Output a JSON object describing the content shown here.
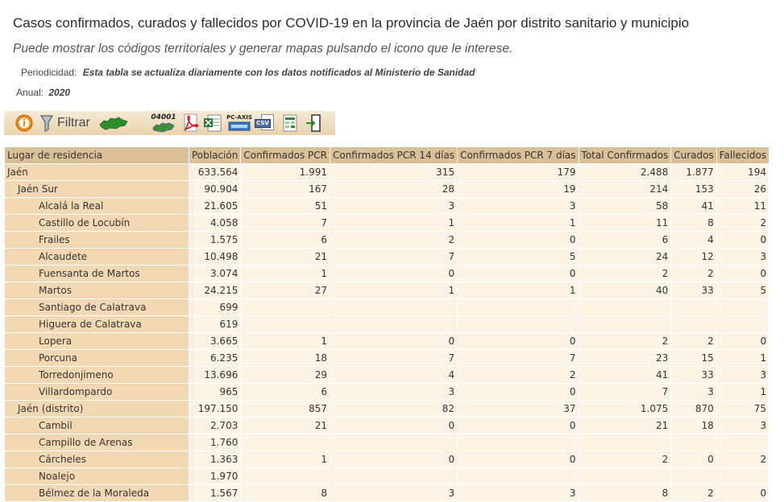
{
  "header": {
    "title": "Casos confirmados, curados y fallecidos por COVID-19 en la provincia de Jaén por distrito sanitario y municipio",
    "subtitle": "Puede mostrar los códigos territoriales y generar mapas pulsando el icono que le interese.",
    "periodicidad_label": "Periodicidad:",
    "periodicidad_value": "Esta tabla se actualiza diariamente con los datos notificados al Ministerio de Sanidad",
    "anual_label": "Anual:",
    "anual_value": "2020"
  },
  "toolbar": {
    "filter_label": "Filtrar",
    "codes_label": "04001",
    "pcaxis_label": "PC-AXIS",
    "csv_label": "CSV",
    "icons": [
      "info-icon",
      "filter-icon",
      "map-icon",
      "codes-map-icon",
      "pdf-icon",
      "excel-icon",
      "pcaxis-icon",
      "csv-icon",
      "spreadsheet-icon",
      "exit-icon"
    ]
  },
  "table": {
    "columns": [
      "Lugar de residencia",
      "Población",
      "Confirmados PCR",
      "Confirmados PCR 14 días",
      "Confirmados PCR 7 días",
      "Total Confirmados",
      "Curados",
      "Fallecidos"
    ],
    "rows": [
      {
        "level": 0,
        "cells": [
          "Jaén",
          "633.564",
          "1.991",
          "315",
          "179",
          "2.488",
          "1.877",
          "194"
        ]
      },
      {
        "level": 1,
        "cells": [
          "Jaén Sur",
          "90.904",
          "167",
          "28",
          "19",
          "214",
          "153",
          "26"
        ]
      },
      {
        "level": 2,
        "cells": [
          "Alcalá la Real",
          "21.605",
          "51",
          "3",
          "3",
          "58",
          "41",
          "11"
        ]
      },
      {
        "level": 2,
        "cells": [
          "Castillo de Locubín",
          "4.058",
          "7",
          "1",
          "1",
          "11",
          "8",
          "2"
        ]
      },
      {
        "level": 2,
        "cells": [
          "Frailes",
          "1.575",
          "6",
          "2",
          "0",
          "6",
          "4",
          "0"
        ]
      },
      {
        "level": 2,
        "cells": [
          "Alcaudete",
          "10.498",
          "21",
          "7",
          "5",
          "24",
          "12",
          "3"
        ]
      },
      {
        "level": 2,
        "cells": [
          "Fuensanta de Martos",
          "3.074",
          "1",
          "0",
          "0",
          "2",
          "2",
          "0"
        ]
      },
      {
        "level": 2,
        "cells": [
          "Martos",
          "24.215",
          "27",
          "1",
          "1",
          "40",
          "33",
          "5"
        ]
      },
      {
        "level": 2,
        "cells": [
          "Santiago de Calatrava",
          "699",
          "",
          "",
          "",
          "",
          "",
          ""
        ]
      },
      {
        "level": 2,
        "cells": [
          "Higuera de Calatrava",
          "619",
          "",
          "",
          "",
          "",
          "",
          ""
        ]
      },
      {
        "level": 2,
        "cells": [
          "Lopera",
          "3.665",
          "1",
          "0",
          "0",
          "2",
          "2",
          "0"
        ]
      },
      {
        "level": 2,
        "cells": [
          "Porcuna",
          "6.235",
          "18",
          "7",
          "7",
          "23",
          "15",
          "1"
        ]
      },
      {
        "level": 2,
        "cells": [
          "Torredonjimeno",
          "13.696",
          "29",
          "4",
          "2",
          "41",
          "33",
          "3"
        ]
      },
      {
        "level": 2,
        "cells": [
          "Villardompardo",
          "965",
          "6",
          "3",
          "0",
          "7",
          "3",
          "1"
        ]
      },
      {
        "level": 1,
        "cells": [
          "Jaén (distrito)",
          "197.150",
          "857",
          "82",
          "37",
          "1.075",
          "870",
          "75"
        ]
      },
      {
        "level": 2,
        "cells": [
          "Cambil",
          "2.703",
          "21",
          "0",
          "0",
          "21",
          "18",
          "3"
        ]
      },
      {
        "level": 2,
        "cells": [
          "Campillo de Arenas",
          "1.760",
          "",
          "",
          "",
          "",
          "",
          ""
        ]
      },
      {
        "level": 2,
        "cells": [
          "Cárcheles",
          "1.363",
          "1",
          "0",
          "0",
          "2",
          "0",
          "2"
        ]
      },
      {
        "level": 2,
        "cells": [
          "Noalejo",
          "1.970",
          "",
          "",
          "",
          "",
          "",
          ""
        ]
      },
      {
        "level": 2,
        "cells": [
          "Bélmez de la Moraleda",
          "1.567",
          "8",
          "3",
          "3",
          "8",
          "2",
          "0"
        ]
      }
    ]
  }
}
